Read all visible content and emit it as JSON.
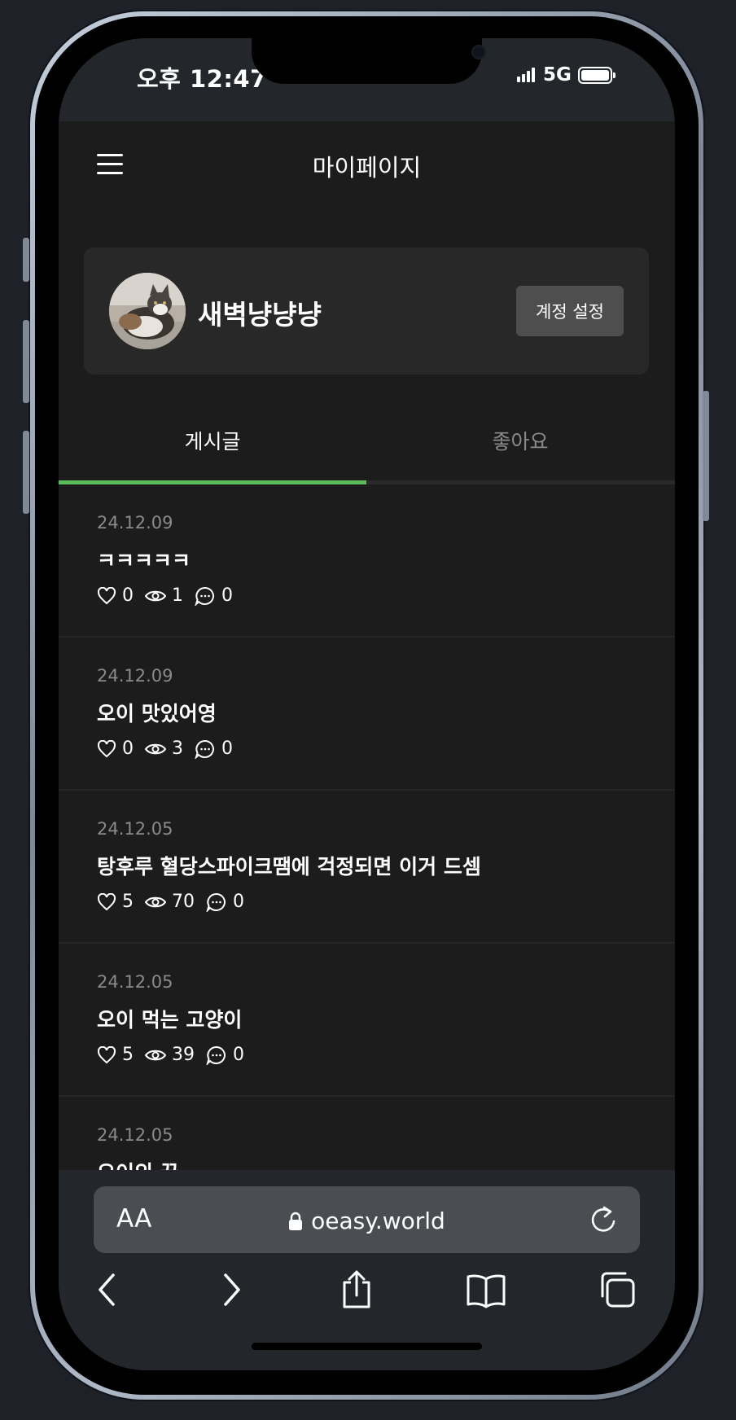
{
  "status_bar": {
    "time": "오후 12:47",
    "network": "5G",
    "battery_level": 1.0
  },
  "header": {
    "title": "마이페이지",
    "menu_icon": "hamburger-menu-icon"
  },
  "profile": {
    "username": "새벽냥냥냥",
    "account_settings_label": "계정 설정",
    "avatar_icon": "cat-avatar"
  },
  "tabs": [
    {
      "label": "게시글",
      "active": true
    },
    {
      "label": "좋아요",
      "active": false
    }
  ],
  "accent_color": "#5cbc5b",
  "posts": [
    {
      "date": "24.12.09",
      "title": "ㅋㅋㅋㅋㅋ",
      "likes": "0",
      "views": "1",
      "comments": "0"
    },
    {
      "date": "24.12.09",
      "title": "오이 맛있어영",
      "likes": "0",
      "views": "3",
      "comments": "0"
    },
    {
      "date": "24.12.05",
      "title": "탕후루 혈당스파이크땜에 걱정되면 이거 드셈",
      "likes": "5",
      "views": "70",
      "comments": "0"
    },
    {
      "date": "24.12.05",
      "title": "오이 먹는 고양이",
      "likes": "5",
      "views": "39",
      "comments": "0"
    },
    {
      "date": "24.12.05",
      "title": "오이의 꿈",
      "likes": "",
      "views": "",
      "comments": ""
    }
  ],
  "browser": {
    "text_size_label": "AA",
    "url": "oeasy.world",
    "icons": [
      "lock-icon",
      "reload-icon",
      "back-icon",
      "forward-icon",
      "share-icon",
      "bookmarks-icon",
      "tabs-icon"
    ]
  }
}
